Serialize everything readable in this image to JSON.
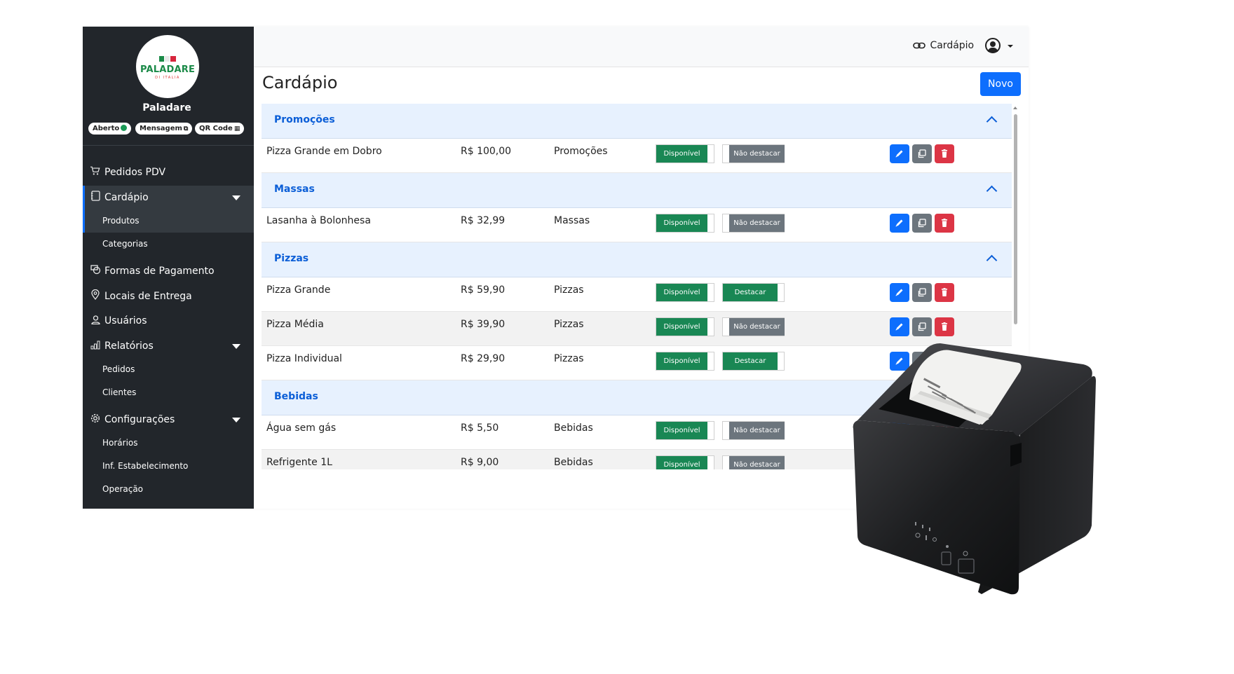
{
  "sidebar": {
    "logo": {
      "brand": "PALADARE",
      "sub": "DI ITALIA"
    },
    "store_name": "Paladare",
    "pills": {
      "open": "Aberto",
      "message": "Mensagem",
      "qrcode": "QR Code"
    },
    "nav": {
      "pedidos_pdv": "Pedidos PDV",
      "cardapio": "Cardápio",
      "produtos": "Produtos",
      "categorias": "Categorias",
      "formas_pagamento": "Formas de Pagamento",
      "locais_entrega": "Locais de Entrega",
      "usuarios": "Usuários",
      "relatorios": "Relatórios",
      "rel_pedidos": "Pedidos",
      "rel_clientes": "Clientes",
      "configuracoes": "Configurações",
      "horarios": "Horários",
      "inf_estabelecimento": "Inf. Estabelecimento",
      "operacao": "Operação"
    },
    "icons": {
      "pedidos_pdv": "cart-icon",
      "cardapio": "book-icon",
      "formas_pagamento": "cash-icon",
      "locais_entrega": "map-pin-icon",
      "usuarios": "person-icon",
      "relatorios": "bar-chart-icon",
      "configuracoes": "gear-icon"
    }
  },
  "topbar": {
    "link_label": "Cardápio",
    "link_icon": "link-icon",
    "user_icon": "user-circle-icon"
  },
  "main": {
    "title": "Cardápio",
    "new_button": "Novo",
    "labels": {
      "available": "Disponível",
      "highlight": "Destacar",
      "no_highlight": "Não destacar"
    },
    "categories": [
      {
        "name": "Promoções",
        "products": [
          {
            "name": "Pizza Grande em Dobro",
            "price": "R$ 100,00",
            "category": "Promoções",
            "available": true,
            "highlighted": false
          }
        ]
      },
      {
        "name": "Massas",
        "products": [
          {
            "name": "Lasanha à Bolonhesa",
            "price": "R$ 32,99",
            "category": "Massas",
            "available": true,
            "highlighted": false
          }
        ]
      },
      {
        "name": "Pizzas",
        "products": [
          {
            "name": "Pizza Grande",
            "price": "R$ 59,90",
            "category": "Pizzas",
            "available": true,
            "highlighted": true
          },
          {
            "name": "Pizza Média",
            "price": "R$ 39,90",
            "category": "Pizzas",
            "available": true,
            "highlighted": false
          },
          {
            "name": "Pizza Individual",
            "price": "R$ 29,90",
            "category": "Pizzas",
            "available": true,
            "highlighted": true
          }
        ]
      },
      {
        "name": "Bebidas",
        "products": [
          {
            "name": "Água sem gás",
            "price": "R$ 5,50",
            "category": "Bebidas",
            "available": true,
            "highlighted": false
          },
          {
            "name": "Refrigente 1L",
            "price": "R$ 9,00",
            "category": "Bebidas",
            "available": true,
            "highlighted": false
          }
        ]
      }
    ]
  },
  "colors": {
    "sidebar_bg": "#22262b",
    "primary": "#0d6efd",
    "success": "#198754",
    "secondary": "#6c757d",
    "danger": "#dc3545",
    "category_bg": "#e7f1fe"
  }
}
